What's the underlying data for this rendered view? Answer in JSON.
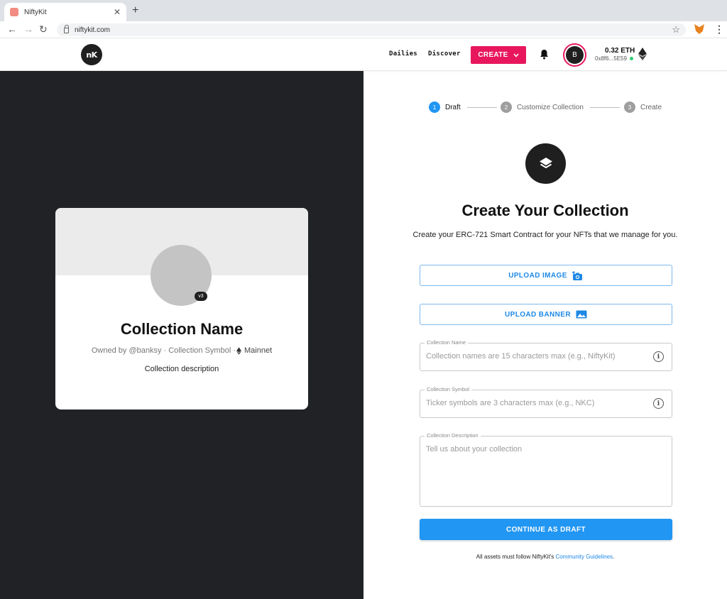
{
  "browser": {
    "tab_title": "NiftyKit",
    "tab_close": "✕",
    "new_tab": "+",
    "back": "←",
    "forward": "→",
    "reload": "↻",
    "url": "niftykit.com",
    "bookmark": "☆",
    "menu": "⋮"
  },
  "header": {
    "logo": "nK",
    "nav": [
      "Dailies",
      "Discover"
    ],
    "create_label": "CREATE",
    "create_chevron": "⌄",
    "avatar_initial": "B",
    "eth_balance": "0.32 ETH",
    "wallet_address": "0x8f6...5E59",
    "colors": {
      "accent": "#e8175d",
      "connected": "#2ecc71"
    }
  },
  "preview_card": {
    "badge": "v3",
    "title": "Collection Name",
    "owner_text": "Owned by @banksy · Collection Symbol · ",
    "network": "Mainnet",
    "description": "Collection description"
  },
  "stepper": {
    "steps": [
      {
        "num": "1",
        "label": "Draft",
        "active": true
      },
      {
        "num": "2",
        "label": "Customize Collection",
        "active": false
      },
      {
        "num": "3",
        "label": "Create",
        "active": false
      }
    ],
    "colors": {
      "active": "#2196f3",
      "inactive": "#9e9e9e"
    }
  },
  "form": {
    "title": "Create Your Collection",
    "subtitle": "Create your ERC-721 Smart Contract for your NFTs that we manage for you.",
    "upload_image": "UPLOAD IMAGE",
    "upload_banner": "UPLOAD BANNER",
    "name_label": "Collection Name",
    "name_placeholder": "Collection names are 15 characters max (e.g., NiftyKit)",
    "symbol_label": "Collection Symbol",
    "symbol_placeholder": "Ticker symbols are 3 characters max (e.g., NKC)",
    "description_label": "Collection Description",
    "description_placeholder": "Tell us about your collection",
    "info": "i",
    "continue_label": "CONTINUE AS DRAFT",
    "footer_prefix": "All assets must follow NiftyKit's ",
    "footer_link": "Community Guidelines",
    "footer_suffix": "."
  }
}
